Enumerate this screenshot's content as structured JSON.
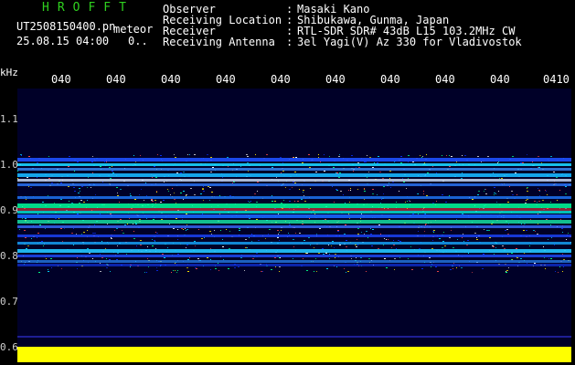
{
  "header": {
    "logo": "HROFFT",
    "file": "UT2508150400.pn",
    "meteor": "meteor",
    "date": "25.08.15 04:00",
    "count": "0.."
  },
  "info": [
    {
      "k": "Observer",
      "v": "Masaki Kano"
    },
    {
      "k": "Receiving Location",
      "v": "Shibukawa, Gunma, Japan"
    },
    {
      "k": "Receiver",
      "v": "RTL-SDR SDR# 43dB L15 103.2MHz CW"
    },
    {
      "k": "Receiving Antenna",
      "v": "3el Yagi(V) Az 330 for Vladivostok"
    }
  ],
  "plot": {
    "y_unit": "kHz",
    "x_ticks": [
      "040",
      "040",
      "040",
      "040",
      "040",
      "040",
      "040",
      "040",
      "040",
      "0410"
    ],
    "y_ticks": [
      "1.1",
      "1.0",
      "0.9",
      "0.8",
      "0.7",
      "0.6"
    ]
  },
  "colors": {
    "background": "#000000",
    "plot_bg": "#000028",
    "logo": "#2fd11f",
    "signal_band": "#ffff00"
  }
}
